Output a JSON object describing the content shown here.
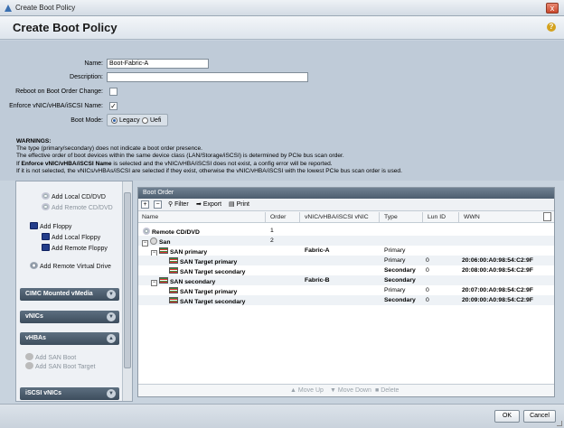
{
  "window": {
    "title": "Create Boot Policy",
    "close_glyph": "x"
  },
  "page": {
    "title": "Create Boot Policy",
    "help_glyph": "?"
  },
  "form": {
    "name_label": "Name:",
    "name_value": "Boot-Fabric-A",
    "description_label": "Description:",
    "description_value": "",
    "reboot_label": "Reboot on Boot Order Change:",
    "reboot_checked": false,
    "enforce_label": "Enforce vNIC/vHBA/iSCSI Name:",
    "enforce_check": "✓",
    "boot_mode_label": "Boot Mode:",
    "boot_mode_options": [
      "Legacy",
      "Uefi"
    ],
    "boot_mode_selected": "Legacy"
  },
  "warnings": {
    "title": "WARNINGS:",
    "line1": "The type (primary/secondary) does not indicate a boot order presence.",
    "line2": "The effective order of boot devices within the same device class (LAN/Storage/iSCSI) is determined by PCIe bus scan order.",
    "line3_prefix": "If ",
    "line3_bold": "Enforce vNIC/vHBA/iSCSI Name",
    "line3_suffix": " is selected and the vNIC/vHBA/iSCSI does not exist, a config error will be reported.",
    "line4": "If it is not selected, the vNICs/vHBAs/iSCSI are selected if they exist, otherwise the vNIC/vHBA/iSCSI with the lowest PCIe bus scan order is used."
  },
  "left_panel": {
    "items": [
      "Add Local CD/DVD",
      "Add Remote CD/DVD",
      "Add Floppy",
      "Add Local Floppy",
      "Add Remote Floppy",
      "Add Remote Virtual Drive"
    ],
    "sections": [
      "CIMC Mounted vMedia",
      "vNICs",
      "vHBAs",
      "iSCSI vNICs"
    ],
    "vhba_items": [
      "Add SAN Boot",
      "Add SAN Boot Target"
    ]
  },
  "boot_order": {
    "title": "Boot Order",
    "toolbar": {
      "add": "+",
      "remove": "−",
      "filter": "Filter",
      "export": "Export",
      "print": "Print"
    },
    "columns": [
      "Name",
      "Order",
      "vNIC/vHBA/iSCSI vNIC",
      "Type",
      "Lun ID",
      "WWN"
    ],
    "rows": [
      {
        "name": "Remote CD/DVD",
        "order": "1",
        "vnic": "",
        "type": "",
        "lun": "",
        "wwn": ""
      },
      {
        "name": "San",
        "order": "2",
        "vnic": "",
        "type": "",
        "lun": "",
        "wwn": ""
      },
      {
        "name": "SAN primary",
        "order": "",
        "vnic": "Fabric-A",
        "type": "Primary",
        "lun": "",
        "wwn": ""
      },
      {
        "name": "SAN Target primary",
        "order": "",
        "vnic": "",
        "type": "Primary",
        "lun": "0",
        "wwn": "20:06:00:A0:98:54:C2:9F"
      },
      {
        "name": "SAN Target secondary",
        "order": "",
        "vnic": "",
        "type": "Secondary",
        "lun": "0",
        "wwn": "20:08:00:A0:98:54:C2:9F"
      },
      {
        "name": "SAN secondary",
        "order": "",
        "vnic": "Fabric-B",
        "type": "Secondary",
        "lun": "",
        "wwn": ""
      },
      {
        "name": "SAN Target primary",
        "order": "",
        "vnic": "",
        "type": "Primary",
        "lun": "0",
        "wwn": "20:07:00:A0:98:54:C2:9F"
      },
      {
        "name": "SAN Target secondary",
        "order": "",
        "vnic": "",
        "type": "Secondary",
        "lun": "0",
        "wwn": "20:09:00:A0:98:54:C2:9F"
      }
    ],
    "bottom": {
      "move_up": "Move Up",
      "move_down": "Move Down",
      "delete": "Delete"
    }
  },
  "footer": {
    "ok": "OK",
    "cancel": "Cancel"
  }
}
